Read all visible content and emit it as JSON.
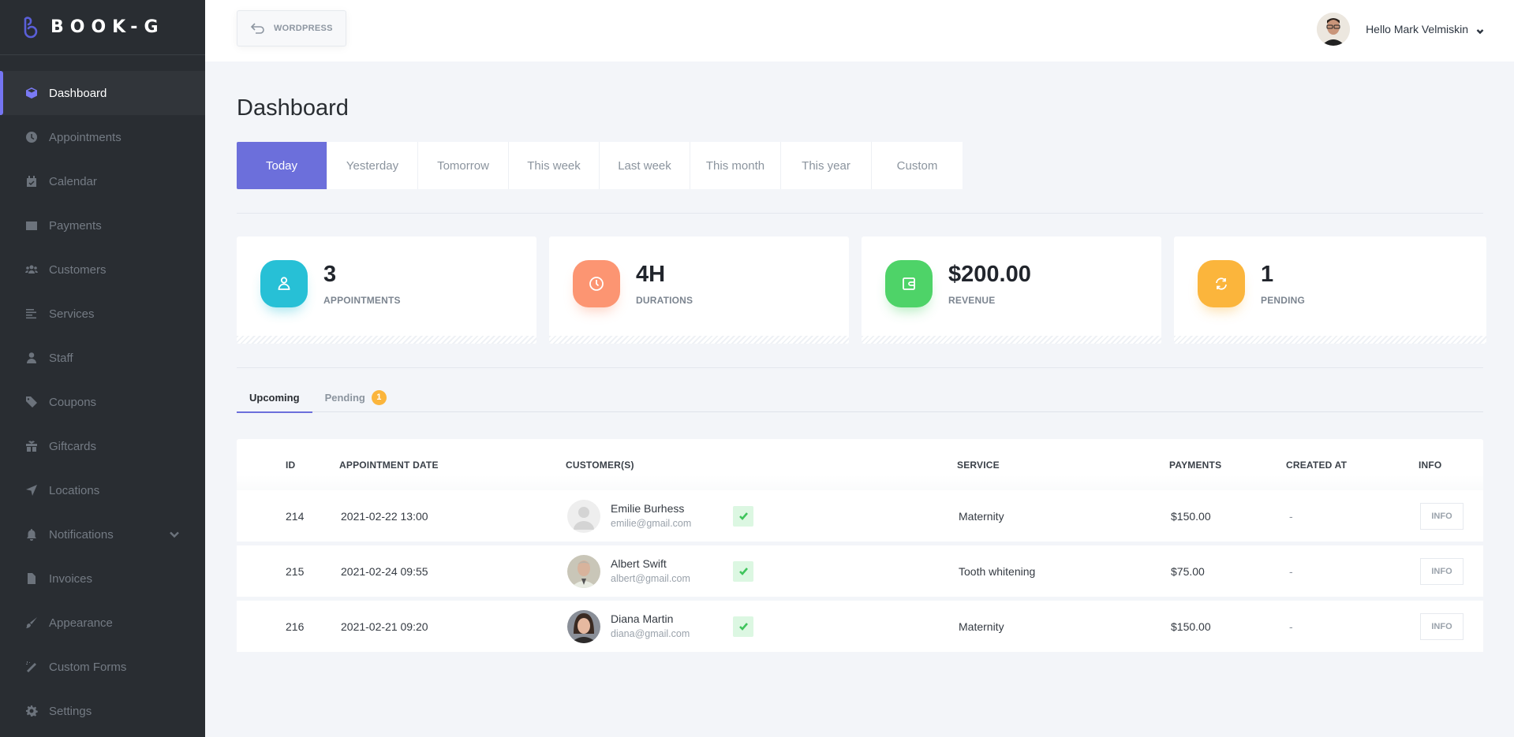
{
  "brand": {
    "name": "BOOK-G"
  },
  "sidebar": {
    "items": [
      {
        "label": "Dashboard",
        "icon": "cube-icon",
        "active": true
      },
      {
        "label": "Appointments",
        "icon": "clock-icon"
      },
      {
        "label": "Calendar",
        "icon": "calendar-check-icon"
      },
      {
        "label": "Payments",
        "icon": "wallet-icon"
      },
      {
        "label": "Customers",
        "icon": "users-icon"
      },
      {
        "label": "Services",
        "icon": "list-icon"
      },
      {
        "label": "Staff",
        "icon": "user-icon"
      },
      {
        "label": "Coupons",
        "icon": "tag-icon"
      },
      {
        "label": "Giftcards",
        "icon": "gift-icon"
      },
      {
        "label": "Locations",
        "icon": "location-arrow-icon"
      },
      {
        "label": "Notifications",
        "icon": "bell-icon",
        "has_submenu": true
      },
      {
        "label": "Invoices",
        "icon": "file-icon"
      },
      {
        "label": "Appearance",
        "icon": "brush-icon"
      },
      {
        "label": "Custom Forms",
        "icon": "magic-wand-icon"
      },
      {
        "label": "Settings",
        "icon": "gear-icon"
      }
    ]
  },
  "header": {
    "back_button_label": "WORDPRESS",
    "user_greeting": "Hello Mark Velmiskin"
  },
  "page": {
    "title": "Dashboard"
  },
  "range_tabs": [
    {
      "label": "Today",
      "active": true
    },
    {
      "label": "Yesterday"
    },
    {
      "label": "Tomorrow"
    },
    {
      "label": "This week"
    },
    {
      "label": "Last week"
    },
    {
      "label": "This month"
    },
    {
      "label": "This year"
    },
    {
      "label": "Custom"
    }
  ],
  "stats": [
    {
      "value": "3",
      "label": "APPOINTMENTS",
      "icon": "user-icon",
      "color": "#27c0d6"
    },
    {
      "value": "4H",
      "label": "DURATIONS",
      "icon": "clock-icon",
      "color": "#fc9572"
    },
    {
      "value": "$200.00",
      "label": "REVENUE",
      "icon": "wallet-icon",
      "color": "#4ed368"
    },
    {
      "value": "1",
      "label": "PENDING",
      "icon": "refresh-icon",
      "color": "#fbb53c"
    }
  ],
  "list_tabs": [
    {
      "label": "Upcoming",
      "active": true
    },
    {
      "label": "Pending",
      "badge": "1"
    }
  ],
  "table": {
    "columns": [
      "ID",
      "APPOINTMENT DATE",
      "CUSTOMER(S)",
      "SERVICE",
      "PAYMENTS",
      "CREATED AT",
      "INFO"
    ],
    "rows": [
      {
        "id": "214",
        "date": "2021-02-22 13:00",
        "customer_name": "Emilie Burhess",
        "customer_email": "emilie@gmail.com",
        "avatar": "placeholder",
        "service": "Maternity",
        "payment": "$150.00",
        "created_at": "-",
        "info_label": "INFO"
      },
      {
        "id": "215",
        "date": "2021-02-24 09:55",
        "customer_name": "Albert Swift",
        "customer_email": "albert@gmail.com",
        "avatar": "photo",
        "service": "Tooth whitening",
        "payment": "$75.00",
        "created_at": "-",
        "info_label": "INFO"
      },
      {
        "id": "216",
        "date": "2021-02-21 09:20",
        "customer_name": "Diana Martin",
        "customer_email": "diana@gmail.com",
        "avatar": "photo",
        "service": "Maternity",
        "payment": "$150.00",
        "created_at": "-",
        "info_label": "INFO"
      }
    ]
  },
  "colors": {
    "accent": "#6c6fdb",
    "sidebar_bg": "#292d32",
    "success": "#3fc45c",
    "warning": "#fbb53c"
  }
}
